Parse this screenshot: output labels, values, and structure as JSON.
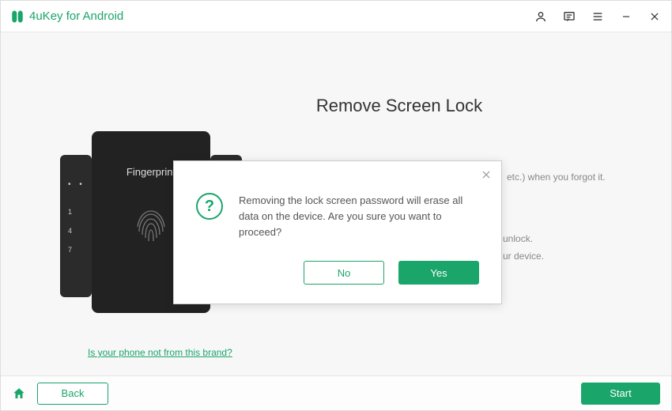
{
  "app": {
    "title": "4uKey for Android"
  },
  "page": {
    "title": "Remove Screen Lock",
    "hint_suffix": "etc.) when you forgot it.",
    "info_line1": "unlock.",
    "info_line2": "ur device.",
    "brand_link": "Is your phone not from this brand?"
  },
  "phone": {
    "fingerprint_label": "Fingerprint",
    "nums": [
      "1",
      "4",
      "7"
    ]
  },
  "modal": {
    "message": "Removing the lock screen password will erase all data on the device. Are you sure you want to proceed?",
    "no_label": "No",
    "yes_label": "Yes"
  },
  "footer": {
    "back_label": "Back",
    "start_label": "Start"
  },
  "colors": {
    "accent": "#1aa56a"
  }
}
